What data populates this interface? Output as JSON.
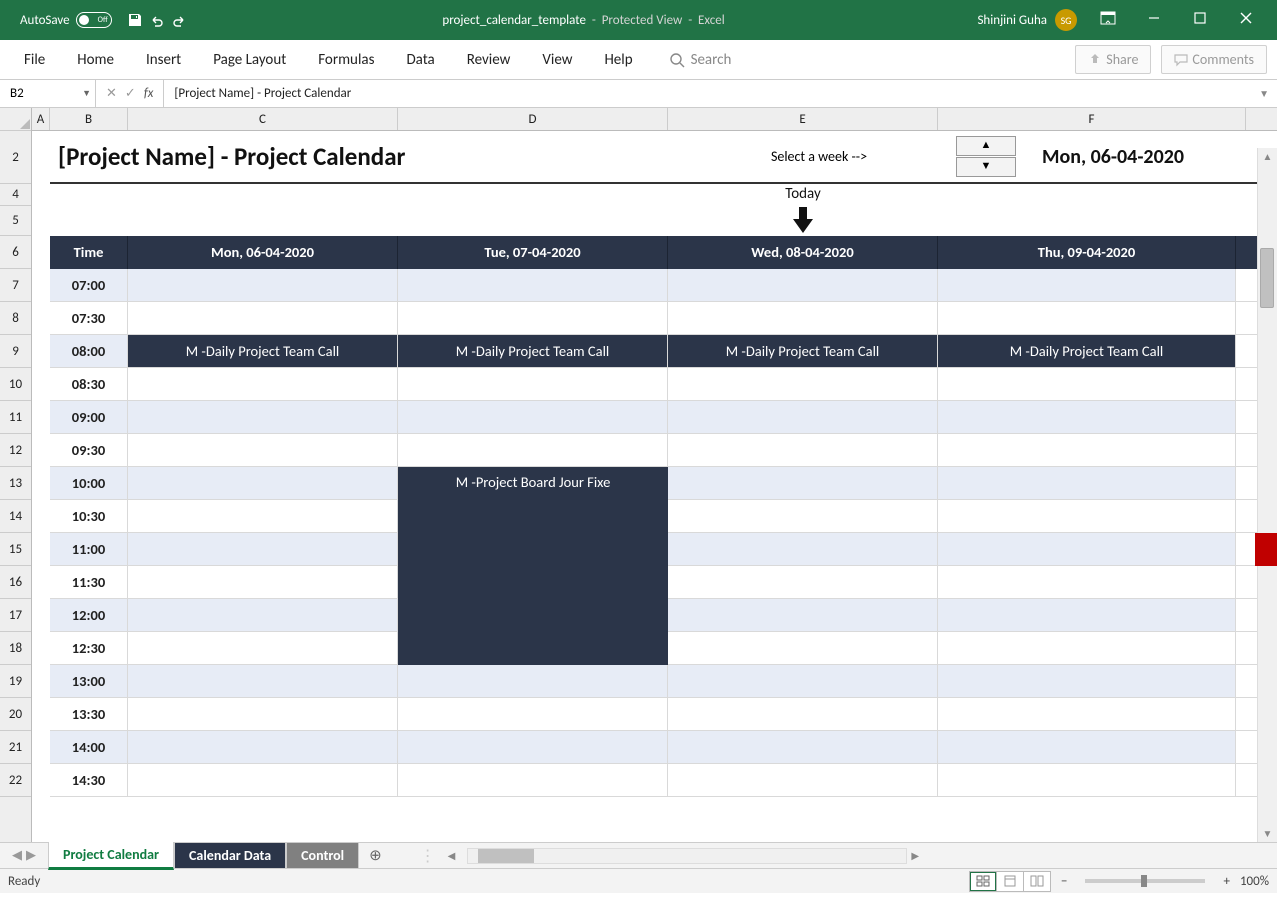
{
  "titleBar": {
    "autosave": "AutoSave",
    "autosaveState": "Off",
    "filename": "project_calendar_template",
    "mode": "Protected View",
    "app": "Excel",
    "user": "Shinjini Guha",
    "userInitials": "SG"
  },
  "ribbon": {
    "tabs": [
      "File",
      "Home",
      "Insert",
      "Page Layout",
      "Formulas",
      "Data",
      "Review",
      "View",
      "Help"
    ],
    "search": "Search",
    "share": "Share",
    "comments": "Comments"
  },
  "formulaBar": {
    "nameBox": "B2",
    "content": "[Project Name] - Project Calendar"
  },
  "columns": [
    "A",
    "B",
    "C",
    "D",
    "E",
    "F"
  ],
  "rowNums": [
    "2",
    "4",
    "5",
    "6",
    "7",
    "8",
    "9",
    "10",
    "11",
    "12",
    "13",
    "14",
    "15",
    "16",
    "17",
    "18",
    "19",
    "20",
    "21",
    "22"
  ],
  "sheet": {
    "title": "[Project Name] - Project Calendar",
    "selectWeek": "Select a week -->",
    "currentDate": "Mon, 06-04-2020",
    "todayLabel": "Today",
    "headers": {
      "time": "Time",
      "days": [
        "Mon, 06-04-2020",
        "Tue, 07-04-2020",
        "Wed, 08-04-2020",
        "Thu, 09-04-2020"
      ]
    },
    "times": [
      "07:00",
      "07:30",
      "08:00",
      "08:30",
      "09:00",
      "09:30",
      "10:00",
      "10:30",
      "11:00",
      "11:30",
      "12:00",
      "12:30",
      "13:00",
      "13:30",
      "14:00",
      "14:30"
    ],
    "dailyCall": "M -Daily Project Team Call",
    "boardFixe": "M -Project Board Jour Fixe"
  },
  "sheetTabs": [
    "Project Calendar",
    "Calendar Data",
    "Control"
  ],
  "statusBar": {
    "ready": "Ready",
    "zoom": "100%"
  }
}
